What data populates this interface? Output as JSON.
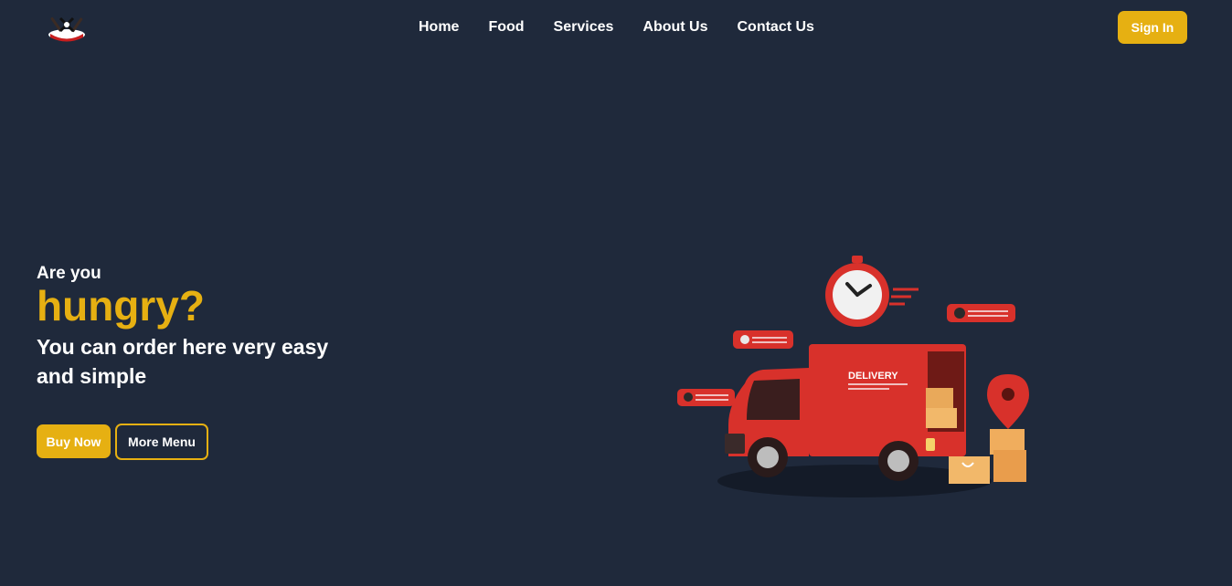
{
  "nav": {
    "logo_icon": "chef-knives-logo",
    "links": [
      "Home",
      "Food",
      "Services",
      "About Us",
      "Contact Us"
    ],
    "signin_label": "Sign In"
  },
  "hero": {
    "pre_title": "Are you",
    "title": "hungry?",
    "subtitle": "You can order here very easy and simple",
    "buy_label": "Buy Now",
    "more_label": "More Menu",
    "truck_label": "DELIVERY"
  },
  "colors": {
    "background": "#1f293b",
    "accent": "#e6b012",
    "truck_red": "#d8312b"
  }
}
